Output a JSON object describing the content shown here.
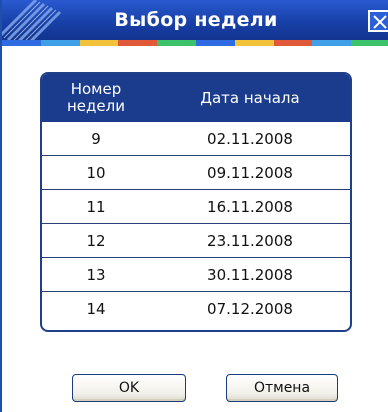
{
  "window": {
    "title": "Выбор недели",
    "close_icon": "close-icon",
    "accent_color": "#1b3c8c"
  },
  "table": {
    "headers": {
      "week_number_line1": "Номер",
      "week_number_line2": "недели",
      "start_date": "Дата начала"
    },
    "rows": [
      {
        "week": "9",
        "date": "02.11.2008"
      },
      {
        "week": "10",
        "date": "09.11.2008"
      },
      {
        "week": "11",
        "date": "16.11.2008"
      },
      {
        "week": "12",
        "date": "23.11.2008"
      },
      {
        "week": "13",
        "date": "30.11.2008"
      },
      {
        "week": "14",
        "date": "07.12.2008"
      }
    ]
  },
  "buttons": {
    "ok_label": "OK",
    "cancel_label": "Отмена"
  }
}
